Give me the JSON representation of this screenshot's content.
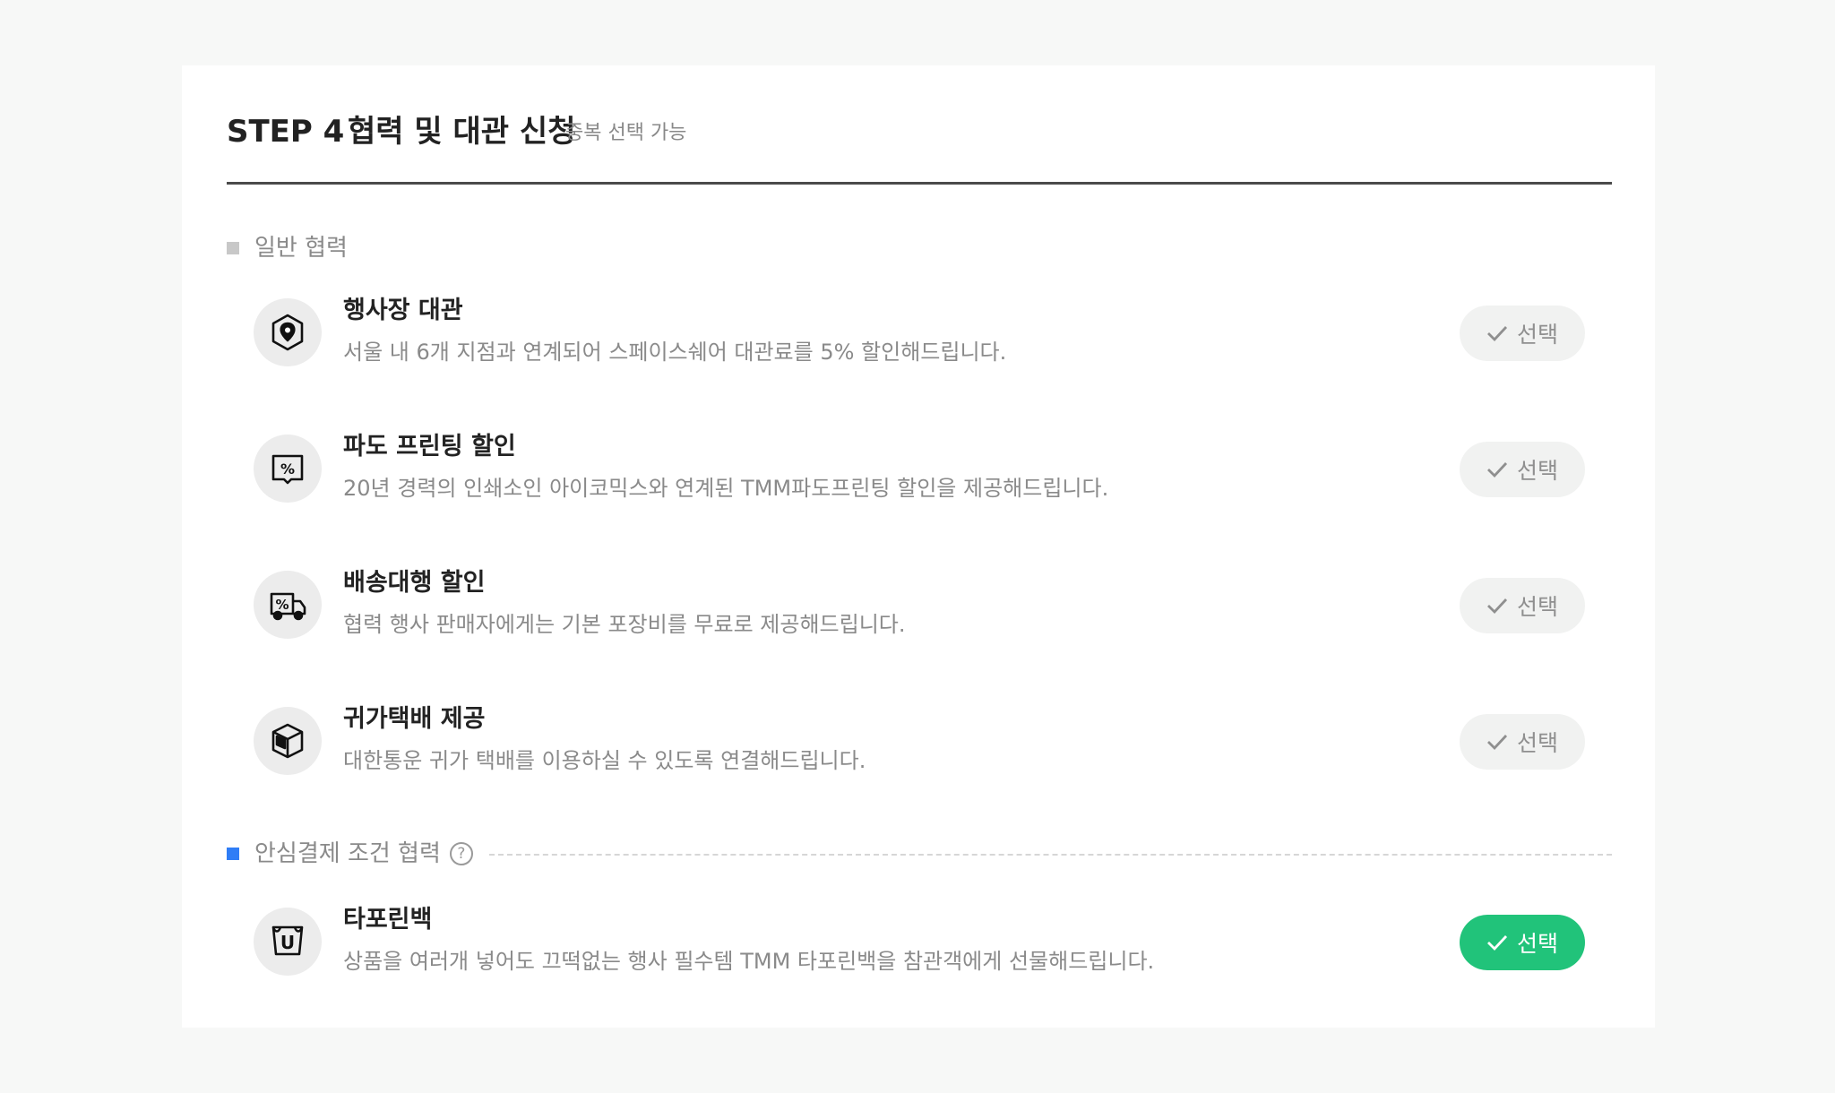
{
  "header": {
    "step": "STEP 4",
    "title": "협력 및 대관 신청",
    "subtitle": "중복 선택 가능"
  },
  "sections": [
    {
      "label": "일반 협력",
      "square_color": "#c8c8c8",
      "items": [
        {
          "name": "행사장 대관",
          "desc": "서울 내 6개 지점과 연계되어 스페이스쉐어 대관료를 5% 할인해드립니다.",
          "icon": "location-pin-icon",
          "button": "선택",
          "selected": false
        },
        {
          "name": "파도 프린팅 할인",
          "desc": "20년 경력의 인쇄소인 아이코믹스와 연계된 TMM파도프린팅 할인을 제공해드립니다.",
          "icon": "print-discount-icon",
          "button": "선택",
          "selected": false
        },
        {
          "name": "배송대행 할인",
          "desc": "협력 행사 판매자에게는 기본 포장비를 무료로 제공해드립니다.",
          "icon": "truck-discount-icon",
          "button": "선택",
          "selected": false
        },
        {
          "name": "귀가택배 제공",
          "desc": "대한통운 귀가 택배를 이용하실 수 있도록 연결해드립니다.",
          "icon": "box-icon",
          "button": "선택",
          "selected": false
        }
      ]
    },
    {
      "label": "안심결제 조건 협력",
      "help": "?",
      "square_color": "#2f7df6",
      "items": [
        {
          "name": "타포린백",
          "desc": "상품을 여러개 넣어도 끄떡없는 행사 필수템 TMM 타포린백을 참관객에게 선물해드립니다.",
          "icon": "tarpaulin-bag-icon",
          "button": "선택",
          "selected": true
        }
      ]
    }
  ],
  "colors": {
    "selected_bg": "#21c37a",
    "unselected_bg": "#f1f2f1",
    "accent_blue": "#2f7df6"
  }
}
